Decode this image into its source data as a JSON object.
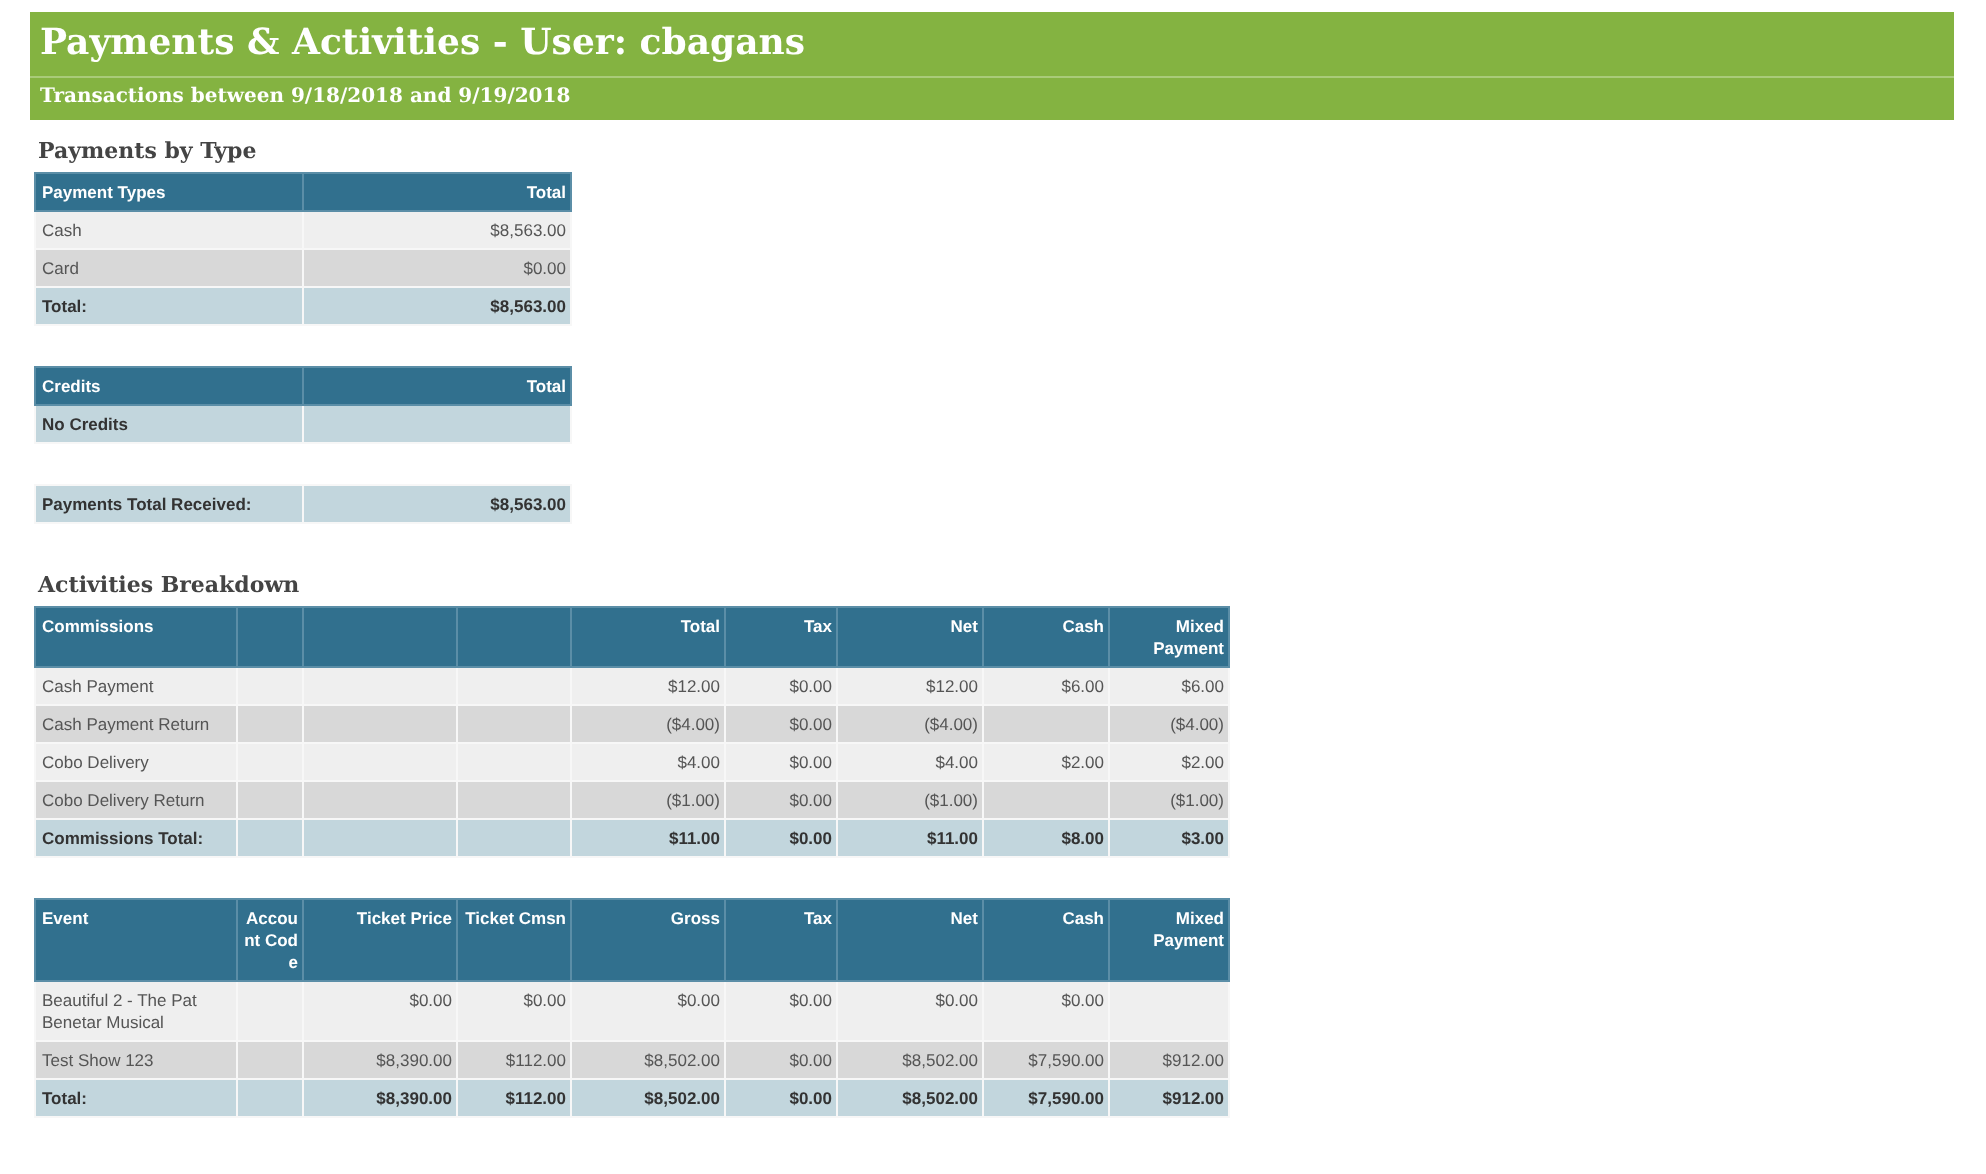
{
  "header": {
    "title": "Payments & Activities - User: cbagans",
    "subtitle": "Transactions between 9/18/2018 and 9/19/2018"
  },
  "sections": [
    {
      "heading": "Payments by Type",
      "tables": [
        {
          "kind": "summary",
          "columns": [
            "Payment Types",
            "Total"
          ],
          "rows": [
            {
              "kind": "item",
              "cells": [
                "Cash",
                "$8,563.00"
              ]
            },
            {
              "kind": "item",
              "cells": [
                "Card",
                "$0.00"
              ]
            },
            {
              "kind": "total",
              "cells": [
                "Total:",
                "$8,563.00"
              ]
            }
          ]
        },
        {
          "kind": "summary",
          "columns": [
            "Credits",
            "Total"
          ],
          "rows": [
            {
              "kind": "total",
              "cells": [
                "No Credits",
                null
              ]
            }
          ]
        },
        {
          "kind": "summary",
          "rows": [
            {
              "kind": "total",
              "cells": [
                "Payments Total Received:",
                "$8,563.00"
              ]
            }
          ]
        }
      ]
    },
    {
      "heading": "Activities Breakdown",
      "tables": [
        {
          "kind": "activity",
          "columns": [
            "Commissions",
            null,
            null,
            null,
            "Total",
            "Tax",
            "Net",
            "Cash",
            "Mixed Payment"
          ],
          "rows": [
            {
              "kind": "item",
              "cells": [
                "Cash Payment",
                null,
                null,
                null,
                "$12.00",
                "$0.00",
                "$12.00",
                "$6.00",
                "$6.00"
              ]
            },
            {
              "kind": "item",
              "cells": [
                "Cash Payment Return",
                null,
                null,
                null,
                "($4.00)",
                "$0.00",
                "($4.00)",
                null,
                "($4.00)"
              ]
            },
            {
              "kind": "item",
              "cells": [
                "Cobo Delivery",
                null,
                null,
                null,
                "$4.00",
                "$0.00",
                "$4.00",
                "$2.00",
                "$2.00"
              ]
            },
            {
              "kind": "item",
              "cells": [
                "Cobo Delivery Return",
                null,
                null,
                null,
                "($1.00)",
                "$0.00",
                "($1.00)",
                null,
                "($1.00)"
              ]
            },
            {
              "kind": "total",
              "cells": [
                "Commissions Total:",
                null,
                null,
                null,
                "$11.00",
                "$0.00",
                "$11.00",
                "$8.00",
                "$3.00"
              ]
            }
          ]
        },
        {
          "kind": "activity",
          "columns": [
            "Event",
            "Account Code",
            "Ticket Price",
            "Ticket Cmsn",
            "Gross",
            "Tax",
            "Net",
            "Cash",
            "Mixed Payment"
          ],
          "rows": [
            {
              "kind": "item",
              "cells": [
                "Beautiful 2 - The Pat Benetar Musical",
                null,
                "$0.00",
                "$0.00",
                "$0.00",
                "$0.00",
                "$0.00",
                "$0.00",
                null
              ]
            },
            {
              "kind": "item",
              "cells": [
                "Test Show 123",
                null,
                "$8,390.00",
                "$112.00",
                "$8,502.00",
                "$0.00",
                "$8,502.00",
                "$7,590.00",
                "$912.00"
              ]
            },
            {
              "kind": "total",
              "cells": [
                "Total:",
                null,
                "$8,390.00",
                "$112.00",
                "$8,502.00",
                "$0.00",
                "$8,502.00",
                "$7,590.00",
                "$912.00"
              ]
            }
          ]
        }
      ]
    }
  ]
}
